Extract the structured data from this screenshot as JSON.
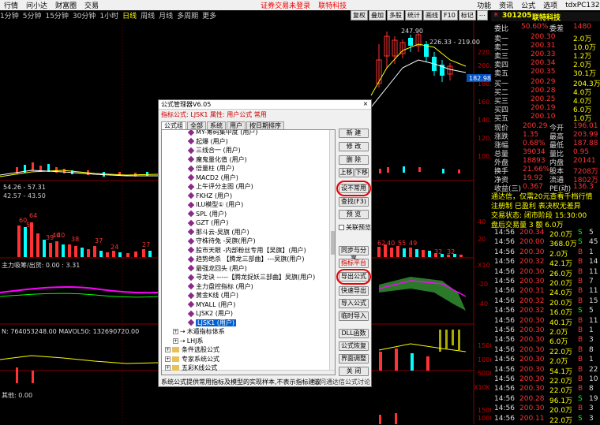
{
  "topbar": {
    "items": [
      "行情",
      "问小达",
      "财富圈",
      "交易"
    ],
    "promo": "证券交易未登录",
    "promo2": "联特科技",
    "right": [
      "功能",
      "资讯",
      "公式",
      "选项"
    ],
    "account": "tdxPC1325"
  },
  "timeframes": [
    "1分钟",
    "5分钟",
    "15分钟",
    "30分钟",
    "1小时",
    "日线",
    "周线",
    "月线",
    "多周期",
    "更多"
  ],
  "timeframe_sel": "日线",
  "chart_toolbar": [
    "复权",
    "叠加",
    "多股",
    "统计",
    "画线",
    "F10",
    "标记",
    "⋯"
  ],
  "chart": {
    "price_axis": [
      "220.00",
      "200.00",
      "180.00",
      "160.00",
      "140.00",
      "120.00",
      "100.00",
      "80.00"
    ],
    "current_price_tag": "182.98",
    "high_label": "247.90",
    "range_label": "226.33 - 219.00",
    "low_marker": "54.26 - 57.31",
    "bottom_left_label": "42.57 - 43.50",
    "vol_labels": [
      "60",
      "64",
      "54",
      "39",
      "40",
      "40",
      "38",
      "37",
      "24",
      "27"
    ],
    "vol_right_labels": [
      "62",
      "40",
      "55",
      "49",
      "32",
      "32"
    ],
    "vol_axis": [
      "40",
      "20"
    ],
    "ind1_label": "主力吸筹/出货: 0.00 : 3.31",
    "ind1_axis": [
      "X10",
      "-20",
      "-40"
    ],
    "volume_line": "N: 764053248.00  MAVOL50: 132690720.00",
    "vol2_axis": [
      "15000",
      "10000",
      "5000",
      "X10K"
    ],
    "ind3_label": "其他: 0.00",
    "ind3_axis": [
      "15000",
      "10000",
      "5000",
      "X10K"
    ]
  },
  "quote": {
    "code": "301205",
    "name": "联特科技",
    "weibi_label": "委比",
    "weibi": "50.60%",
    "weicha_label": "委差",
    "weicha": "1480",
    "sells": [
      {
        "l": "卖五",
        "p": "200.35",
        "v": "30.1万"
      },
      {
        "l": "卖四",
        "p": "200.34",
        "v": "2.0万"
      },
      {
        "l": "卖三",
        "p": "200.33",
        "v": "1.2万"
      },
      {
        "l": "卖二",
        "p": "200.31",
        "v": "10.0万"
      },
      {
        "l": "卖一",
        "p": "200.30",
        "v": "2.0万"
      }
    ],
    "buys": [
      {
        "l": "买一",
        "p": "200.29",
        "v": "204.3万"
      },
      {
        "l": "买二",
        "p": "200.28",
        "v": "4.0万"
      },
      {
        "l": "买三",
        "p": "200.25",
        "v": "4.0万"
      },
      {
        "l": "买四",
        "p": "200.19",
        "v": "6.0万"
      },
      {
        "l": "买五",
        "p": "200.10",
        "v": "1.0万"
      }
    ],
    "stats": [
      {
        "l1": "现价",
        "v1": "200.29",
        "l2": "今开",
        "v2": "196.01"
      },
      {
        "l1": "涨跌",
        "v1": "1.35",
        "l2": "最高",
        "v2": "203.99"
      },
      {
        "l1": "涨幅",
        "v1": "0.68%",
        "l2": "最低",
        "v2": "187.88"
      },
      {
        "l1": "总量",
        "v1": "39034",
        "l2": "量比",
        "v2": "0.95"
      },
      {
        "l1": "外盘",
        "v1": "18893",
        "l2": "内盘",
        "v2": "20141"
      },
      {
        "l1": "换手",
        "v1": "21.66%",
        "l2": "股本",
        "v2": "7208万"
      },
      {
        "l1": "净资",
        "v1": "19.92",
        "l2": "流通",
        "v2": "1802万"
      },
      {
        "l1": "收益(三)",
        "v1": "0.367",
        "l2": "PE(动)",
        "v2": "136.3"
      }
    ],
    "notes": [
      "通达信，仅需20元查看千档行情",
      "注册制 已盈利 表决权无差异",
      "交易状态: 闭市阶段 15:30:00",
      "盘后交易量 3 额 6.0万"
    ],
    "ticks": [
      {
        "t": "14:56",
        "p": "200.34",
        "v": "20.0万",
        "s": "S",
        "n": "5"
      },
      {
        "t": "14:56",
        "p": "200.00",
        "v": "368.0万",
        "s": "S",
        "n": "45"
      },
      {
        "t": "14:56",
        "p": "200.30",
        "v": "2.0万",
        "s": "B",
        "n": "1"
      },
      {
        "t": "14:56",
        "p": "200.32",
        "v": "42.1万",
        "s": "B",
        "n": "14"
      },
      {
        "t": "14:56",
        "p": "200.30",
        "v": "26.0万",
        "s": "B",
        "n": "11"
      },
      {
        "t": "14:56",
        "p": "200.30",
        "v": "20.0万",
        "s": "B",
        "n": "7"
      },
      {
        "t": "14:56",
        "p": "200.31",
        "v": "24.0万",
        "s": "B",
        "n": "11"
      },
      {
        "t": "14:56",
        "p": "200.32",
        "v": "20.0万",
        "s": "B",
        "n": "15"
      },
      {
        "t": "14:56",
        "p": "200.32",
        "v": "16.0万",
        "s": "S",
        "n": "5"
      },
      {
        "t": "14:56",
        "p": "200.30",
        "v": "40.1万",
        "s": "B",
        "n": "11"
      },
      {
        "t": "14:56",
        "p": "200.30",
        "v": "2.0万",
        "s": "B",
        "n": "1"
      },
      {
        "t": "14:56",
        "p": "200.30",
        "v": "6.0万",
        "s": "B",
        "n": "3"
      },
      {
        "t": "14:56",
        "p": "200.30",
        "v": "22.0万",
        "s": "B",
        "n": "8"
      },
      {
        "t": "14:56",
        "p": "200.30",
        "v": "2.0万",
        "s": "B",
        "n": "1"
      },
      {
        "t": "14:56",
        "p": "200.30",
        "v": "54.1万",
        "s": "B",
        "n": "22"
      },
      {
        "t": "14:56",
        "p": "200.30",
        "v": "22.0万",
        "s": "B",
        "n": "10"
      },
      {
        "t": "14:56",
        "p": "200.30",
        "v": "22.0万",
        "s": "B",
        "n": "8"
      },
      {
        "t": "14:56",
        "p": "200.28",
        "v": "96.1万",
        "s": "S",
        "n": "19"
      },
      {
        "t": "14:56",
        "p": "200.30",
        "v": "20.0万",
        "s": "B",
        "n": "3"
      },
      {
        "t": "14:56",
        "p": "200.11",
        "v": "22.0万",
        "s": "S",
        "n": "3"
      }
    ]
  },
  "dialog": {
    "title": "公式管理器V6.05",
    "close": "×",
    "subtitle": "指标公式: LJSK1  属性: 用户公式  常用",
    "tabs": [
      "公式组",
      "全部",
      "系统",
      "用户",
      "按日期排序"
    ],
    "items": [
      "MY-筹码集中度 (用户)",
      "起爆 (用户)",
      "三线合一 (用户)",
      "魔鬼量化值 (用户)",
      "倍量柱 (用户)",
      "MACD2 (用户)",
      "上午评分主图 (用户)",
      "FKHZ (用户)",
      "ILU模型① (用户)",
      "SPL (用户)",
      "GZT (用户)",
      "那斗云-吴旗 (用户)",
      "守株待兔 -吴旗(用户)",
      "股市天眼 -内部粉丝专用【吴旗】(用户)",
      "趋势绝杀 【腾龙三部曲】---吴旗(用户)",
      "最强龙回头 (用户)",
      "寻龙诀 -----【腾龙捉妖三部曲】吴旗(用户)",
      "主力盘控指标 (用户)",
      "黄金K线 (用户)",
      "MYALL (用户)",
      "LJSK2 (用户)",
      "LJSK1 (用户)"
    ],
    "groups": [
      "木遁指标体系",
      "LHJ系",
      "条件选股公式",
      "专家系统公式",
      "五彩K线公式"
    ],
    "buttons_top": [
      "新 建",
      "修 改",
      "删 除",
      "上移",
      "下移",
      "设不常用",
      "查找(F3)",
      "预 览"
    ],
    "checkbox": "关联预览",
    "buttons_bottom": [
      "同步与分享",
      "指标平台",
      "导出公式",
      "快速导出",
      "导入公式",
      "临时导入",
      "DLL函数",
      "公式恢复",
      "界面调整",
      "关 闭"
    ],
    "status_left": "系统公式提供常用指标及模型的实现样本,不表示指标建议",
    "status_right": "访问通达信公式讨论区"
  }
}
